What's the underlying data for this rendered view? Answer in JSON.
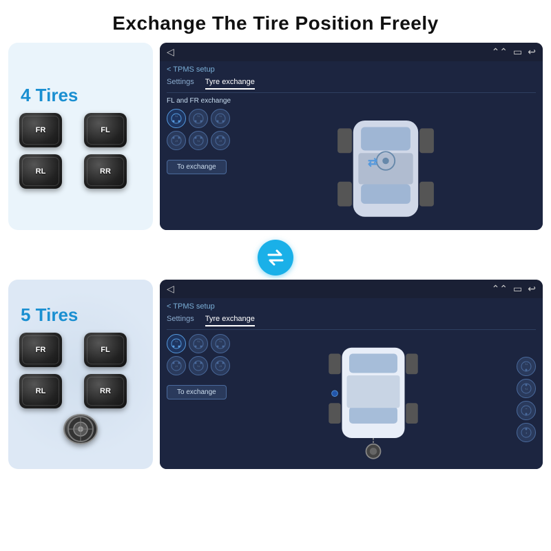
{
  "title": "Exchange The Tire Position Freely",
  "row4": {
    "tire_count": "4 Tires",
    "tires": [
      {
        "label": "FR"
      },
      {
        "label": "FL"
      },
      {
        "label": "RL"
      },
      {
        "label": "RR"
      }
    ],
    "screen": {
      "breadcrumb": "< TPMS setup",
      "tabs": [
        "Settings",
        "Tyre exchange"
      ],
      "active_tab": "Tyre exchange",
      "exchange_label": "FL and FR exchange",
      "exchange_button": "To exchange"
    }
  },
  "row5": {
    "tire_count": "5 Tires",
    "tires": [
      {
        "label": "FR"
      },
      {
        "label": "FL"
      },
      {
        "label": "RL"
      },
      {
        "label": "RR"
      }
    ],
    "spare_label": "spare",
    "screen": {
      "breadcrumb": "< TPMS setup",
      "tabs": [
        "Settings",
        "Tyre exchange"
      ],
      "active_tab": "Tyre exchange",
      "exchange_button": "To exchange"
    }
  },
  "exchange_arrow": "⇄",
  "icons": {
    "back_triangle": "◁",
    "window": "▭",
    "back_arrow": "↩",
    "chevrons": "⌃⌃"
  }
}
